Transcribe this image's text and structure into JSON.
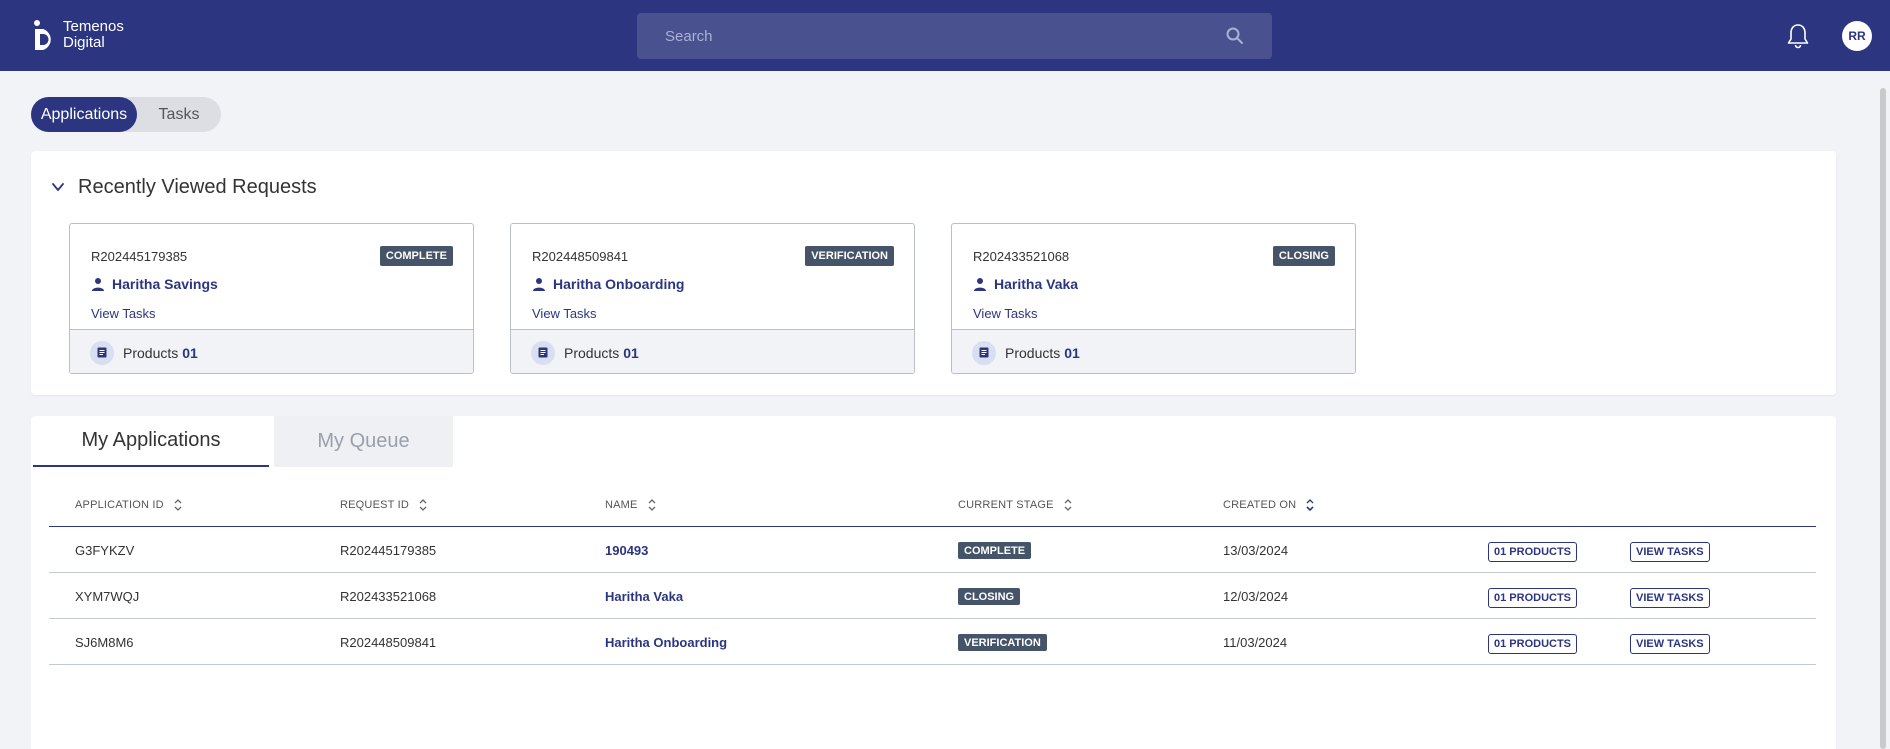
{
  "header": {
    "logo_line1": "Temenos",
    "logo_line2": "Digital",
    "search_placeholder": "Search",
    "avatar_initials": "RR"
  },
  "view_toggle": {
    "active": "Applications",
    "inactive": "Tasks"
  },
  "recent": {
    "title": "Recently Viewed Requests",
    "cards": [
      {
        "request_id": "R202445179385",
        "stage": "COMPLETE",
        "name": "Haritha Savings",
        "view_tasks": "View Tasks",
        "products_label": "Products",
        "products_count": "01"
      },
      {
        "request_id": "R202448509841",
        "stage": "VERIFICATION",
        "name": "Haritha Onboarding",
        "view_tasks": "View Tasks",
        "products_label": "Products",
        "products_count": "01"
      },
      {
        "request_id": "R202433521068",
        "stage": "CLOSING",
        "name": "Haritha Vaka",
        "view_tasks": "View Tasks",
        "products_label": "Products",
        "products_count": "01"
      }
    ]
  },
  "apps": {
    "tabs": {
      "active": "My Applications",
      "inactive": "My Queue"
    },
    "columns": [
      "APPLICATION ID",
      "REQUEST ID",
      "NAME",
      "CURRENT STAGE",
      "CREATED ON"
    ],
    "rows": [
      {
        "app_id": "G3FYKZV",
        "request_id": "R202445179385",
        "name": "190493",
        "stage": "COMPLETE",
        "created": "13/03/2024",
        "products_btn": "01 PRODUCTS",
        "tasks_btn": "VIEW TASKS"
      },
      {
        "app_id": "XYM7WQJ",
        "request_id": "R202433521068",
        "name": "Haritha Vaka",
        "stage": "CLOSING",
        "created": "12/03/2024",
        "products_btn": "01 PRODUCTS",
        "tasks_btn": "VIEW TASKS"
      },
      {
        "app_id": "SJ6M8M6",
        "request_id": "R202448509841",
        "name": "Haritha Onboarding",
        "stage": "VERIFICATION",
        "created": "11/03/2024",
        "products_btn": "01 PRODUCTS",
        "tasks_btn": "VIEW TASKS"
      }
    ]
  },
  "colors": {
    "brand": "#2b3580",
    "badge": "#455468",
    "background": "#f2f3f7"
  },
  "icons": [
    "temenos-logo-icon",
    "search-icon",
    "bell-icon",
    "chevron-down-icon",
    "person-icon",
    "document-icon",
    "sort-icon"
  ]
}
